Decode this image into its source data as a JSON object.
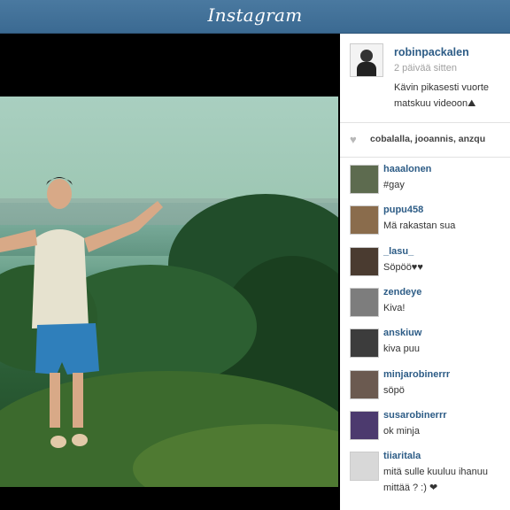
{
  "header": {
    "logo": "Instagram"
  },
  "post": {
    "username": "robinpackalen",
    "time": "2 päivää sitten",
    "caption_line1": "Kävin pikasesti vuorte",
    "caption_line2": "matskuu videoon⛰",
    "likes": "cobalalla, jooannis, anzqu"
  },
  "comments": [
    {
      "user": "haaalonen",
      "text": "#gay",
      "avatar_color": "#5d6b4f"
    },
    {
      "user": "pupu458",
      "text": "Mä rakastan sua",
      "avatar_color": "#8a6c4c"
    },
    {
      "user": "_lasu_",
      "text": "Söpöö♥♥",
      "avatar_color": "#4a3b30"
    },
    {
      "user": "zendeye",
      "text": "Kiva!",
      "avatar_color": "#7d7d7d"
    },
    {
      "user": "anskiuw",
      "text": "kiva puu",
      "avatar_color": "#3c3c3c"
    },
    {
      "user": "minjarobinerrr",
      "text": "söpö",
      "avatar_color": "#6b5a50"
    },
    {
      "user": "susarobinerrr",
      "text": "ok minja",
      "avatar_color": "#4c3a6e"
    },
    {
      "user": "tiiaritala",
      "text": "mitä sulle kuuluu ihanuu",
      "text2": "mittää ? :) ❤",
      "avatar_color": "#d8d8d8"
    }
  ],
  "colors": {
    "topbar": "#3f6d95",
    "link": "#2d5c86"
  }
}
